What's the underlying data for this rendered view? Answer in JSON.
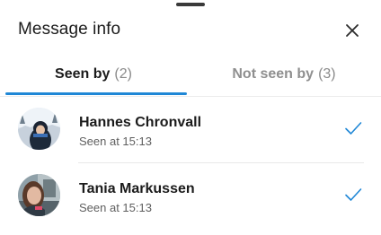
{
  "sheet": {
    "title": "Message info"
  },
  "tabs": [
    {
      "label": "Seen by",
      "count": "(2)",
      "active": true
    },
    {
      "label": "Not seen by",
      "count": "(3)",
      "active": false
    }
  ],
  "viewers": [
    {
      "name": "Hannes Chronvall",
      "status": "Seen at 15:13"
    },
    {
      "name": "Tania Markussen",
      "status": "Seen at 15:13"
    }
  ],
  "colors": {
    "accent": "#1f87d6",
    "check": "#1f87d6"
  },
  "icons": {
    "close": "close-icon",
    "seen": "checkmark-icon"
  }
}
